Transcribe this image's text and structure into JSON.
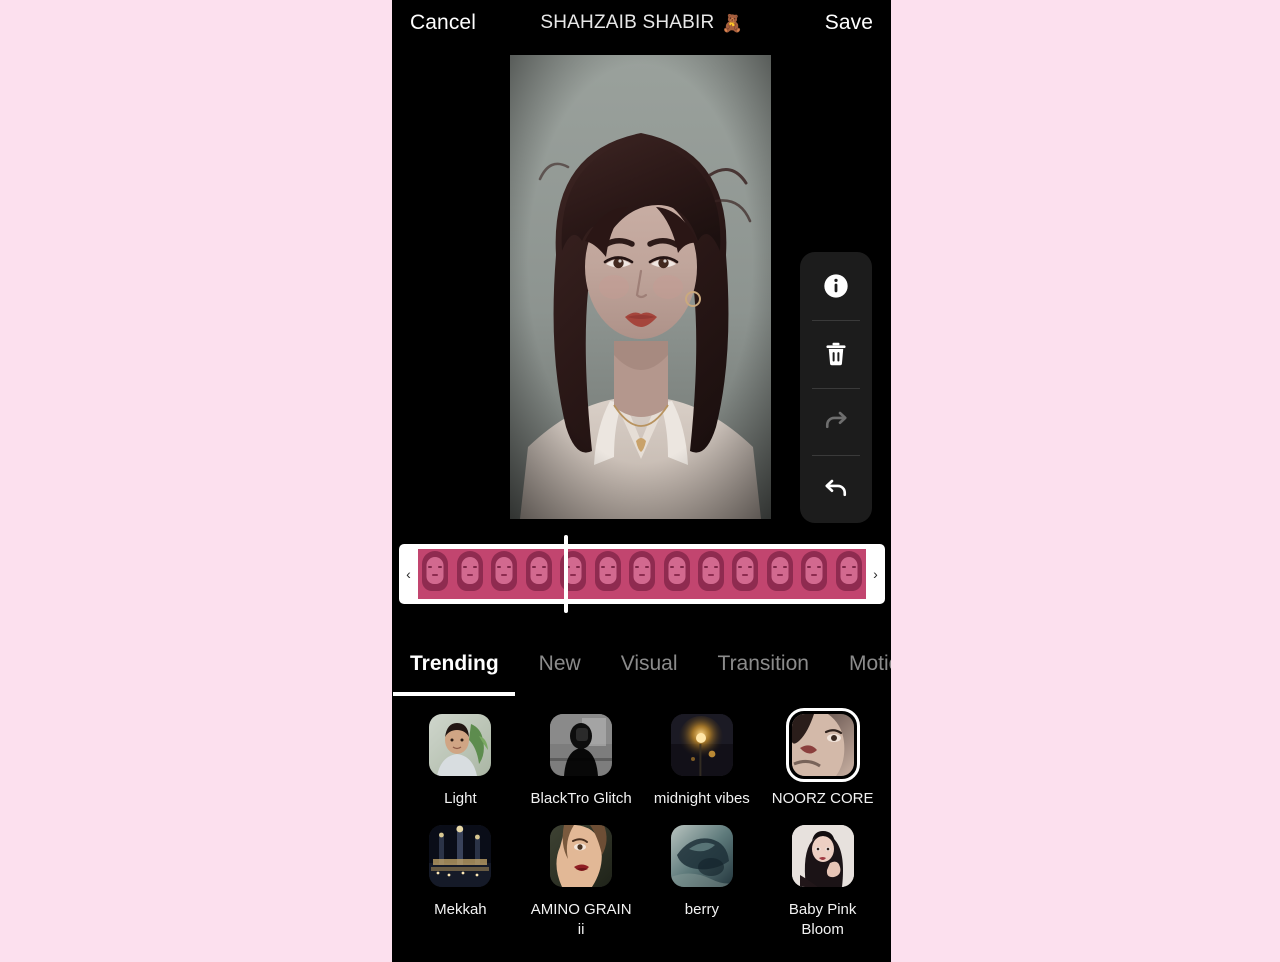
{
  "background_color": "#fce0ee",
  "app": {
    "screen_background": "#000000"
  },
  "top_bar": {
    "cancel_label": "Cancel",
    "project_title": "SHAHZAIB SHABIR",
    "title_emoji": "🧸",
    "save_label": "Save"
  },
  "side_toolbar": {
    "items": [
      {
        "name": "info",
        "glyph": "info-icon",
        "enabled": true
      },
      {
        "name": "delete",
        "glyph": "trash-icon",
        "enabled": true
      },
      {
        "name": "redo",
        "glyph": "redo-icon",
        "enabled": false
      },
      {
        "name": "undo",
        "glyph": "undo-icon",
        "enabled": true
      }
    ]
  },
  "timeline": {
    "left_handle_glyph": "‹",
    "right_handle_glyph": "›",
    "playhead_position_percent": 33,
    "frame_count": 13,
    "frame_tint": "#c2456f"
  },
  "tabs": [
    {
      "label": "Trending",
      "active": true
    },
    {
      "label": "New",
      "active": false
    },
    {
      "label": "Visual",
      "active": false
    },
    {
      "label": "Transition",
      "active": false
    },
    {
      "label": "Motion",
      "active": false
    }
  ],
  "filters": [
    {
      "label": "Light",
      "selected": false
    },
    {
      "label": "BlackTro Glitch",
      "selected": false
    },
    {
      "label": "midnight vibes",
      "selected": false
    },
    {
      "label": "NOORZ CORE",
      "selected": true
    },
    {
      "label": "Mekkah",
      "selected": false
    },
    {
      "label": "AMINO GRAIN ii",
      "selected": false
    },
    {
      "label": "berry",
      "selected": false
    },
    {
      "label": "Baby Pink Bloom",
      "selected": false
    }
  ]
}
